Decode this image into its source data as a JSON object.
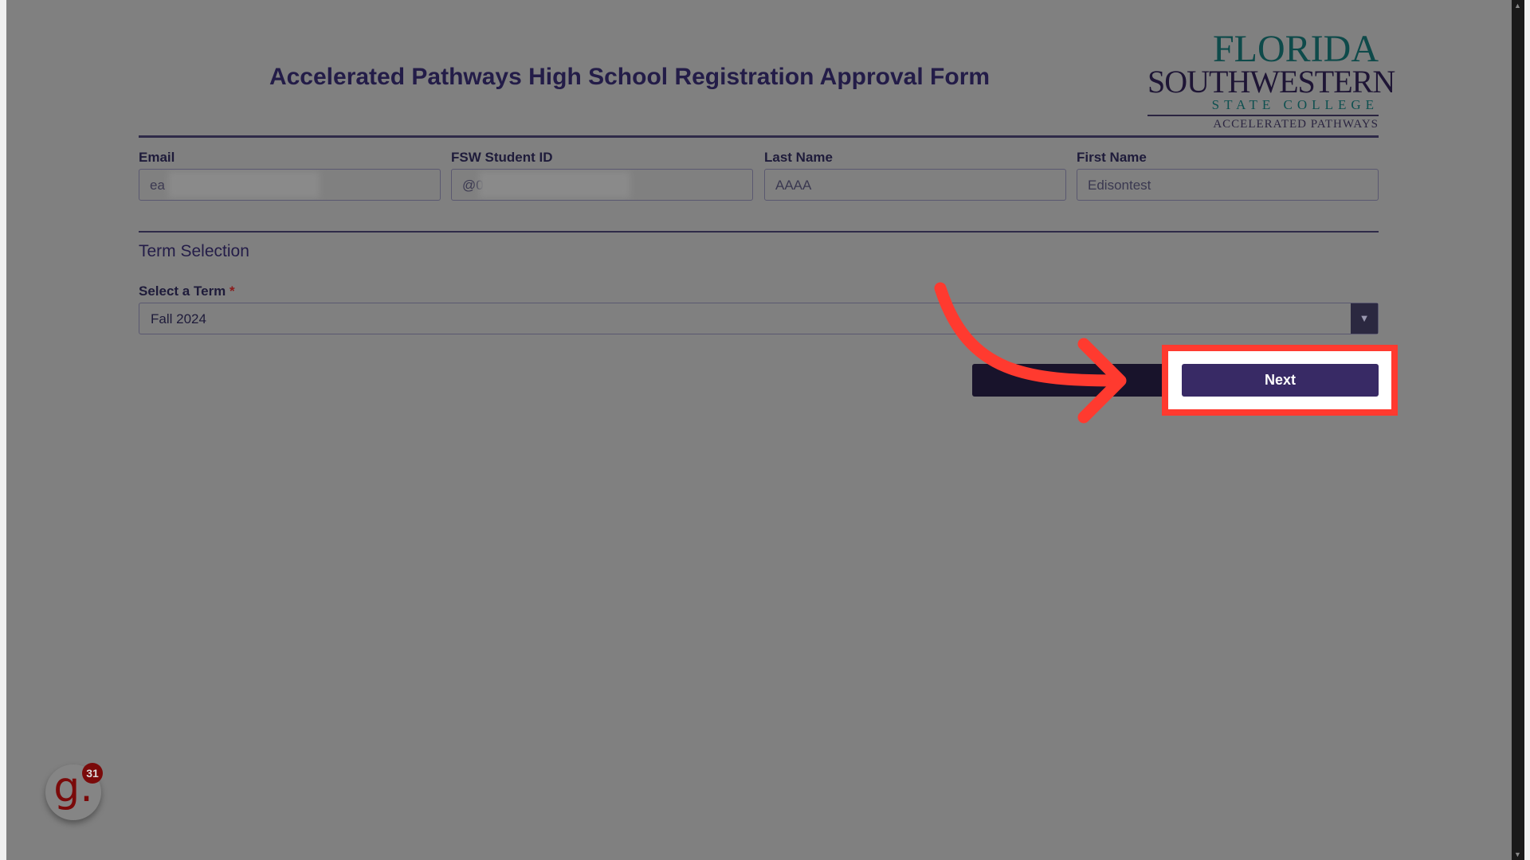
{
  "form": {
    "title": "Accelerated Pathways High School Registration Approval Form",
    "logo": {
      "line1": "FLORIDA",
      "line2": "SOUTHWESTERN",
      "line3": "STATE COLLEGE",
      "line4": "ACCELERATED PATHWAYS"
    },
    "fields": [
      {
        "label": "Email",
        "value": "ea"
      },
      {
        "label": "FSW Student ID",
        "value": "@0"
      },
      {
        "label": "Last Name",
        "value": "AAAA"
      },
      {
        "label": "First Name",
        "value": "Edisontest"
      }
    ],
    "term_section": "Term Selection",
    "term_label": "Select a Term",
    "required_mark": "*",
    "term_value": "Fall 2024",
    "next_label": "Next"
  },
  "widget": {
    "count": "31",
    "glyph": "g."
  },
  "colors": {
    "accent": "#382a65",
    "highlight": "#ff3a2f",
    "overlay": "#808080"
  }
}
